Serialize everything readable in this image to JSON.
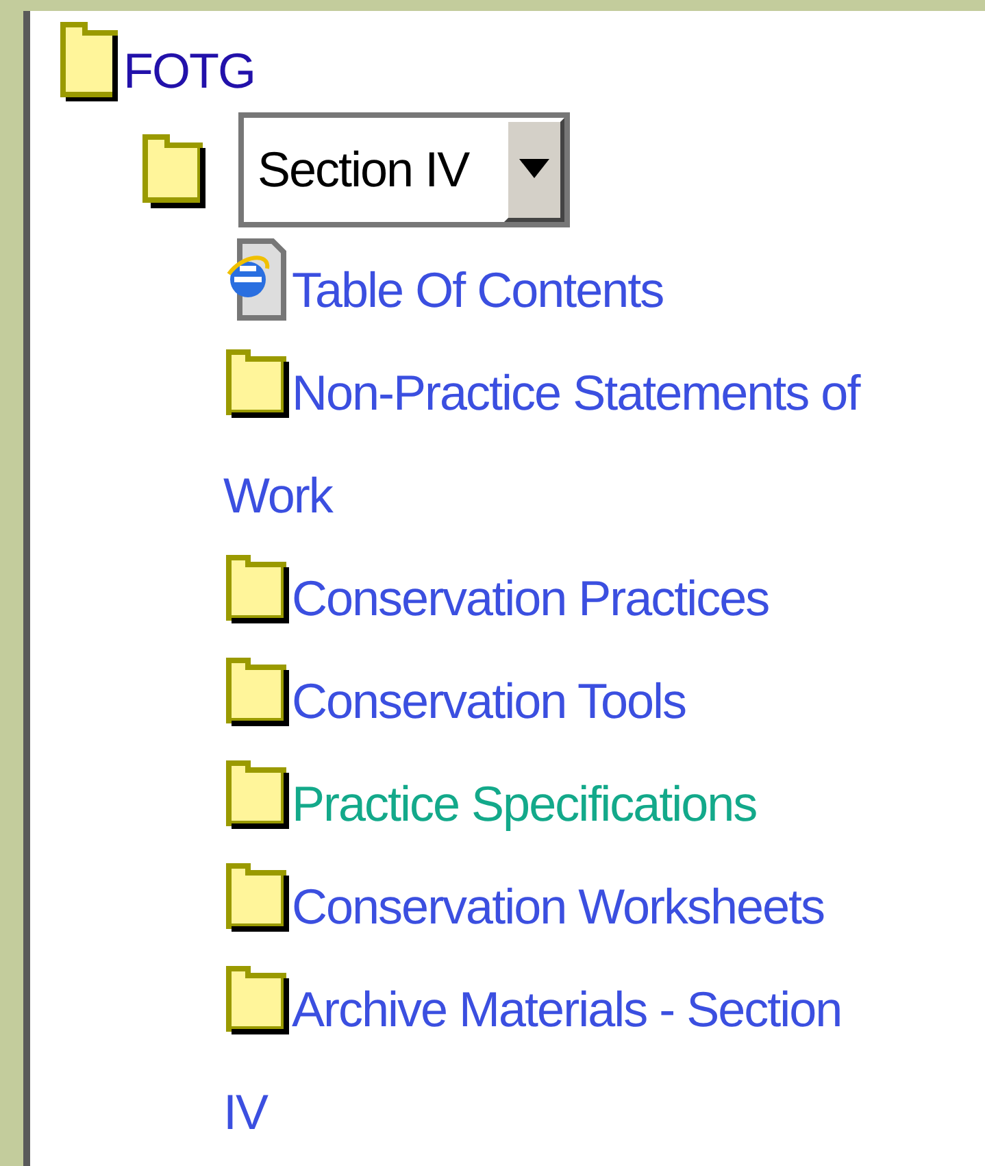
{
  "tree": {
    "label": "FOTG",
    "section_select": {
      "value": "Section IV"
    },
    "items": [
      {
        "kind": "page",
        "label": "Table Of Contents",
        "visited": false
      },
      {
        "kind": "folder",
        "label": "Non-Practice Statements of Work",
        "visited": false
      },
      {
        "kind": "folder",
        "label": "Conservation Practices",
        "visited": false
      },
      {
        "kind": "folder",
        "label": "Conservation Tools",
        "visited": false
      },
      {
        "kind": "folder",
        "label": "Practice Specifications",
        "visited": true
      },
      {
        "kind": "folder",
        "label": "Conservation Worksheets",
        "visited": false
      },
      {
        "kind": "folder",
        "label": "Archive Materials - Section IV",
        "visited": false
      }
    ]
  }
}
